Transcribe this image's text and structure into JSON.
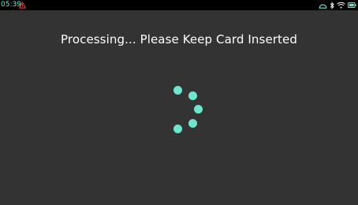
{
  "status_bar": {
    "time": "05:39",
    "warning_icon": "warning-triangle-icon",
    "right_icons": [
      "dashboard-icon",
      "bluetooth-icon",
      "wifi-icon",
      "battery-icon"
    ],
    "colors": {
      "accent": "#6ee6cf",
      "warning": "#e5483d",
      "bar_background": "#000000"
    }
  },
  "main": {
    "message": "Processing... Please Keep Card Inserted",
    "spinner_icon": "loading-spinner-icon",
    "spinner_dot_count": 5,
    "background_color": "#333333",
    "accent_color": "#6ee6cf"
  }
}
